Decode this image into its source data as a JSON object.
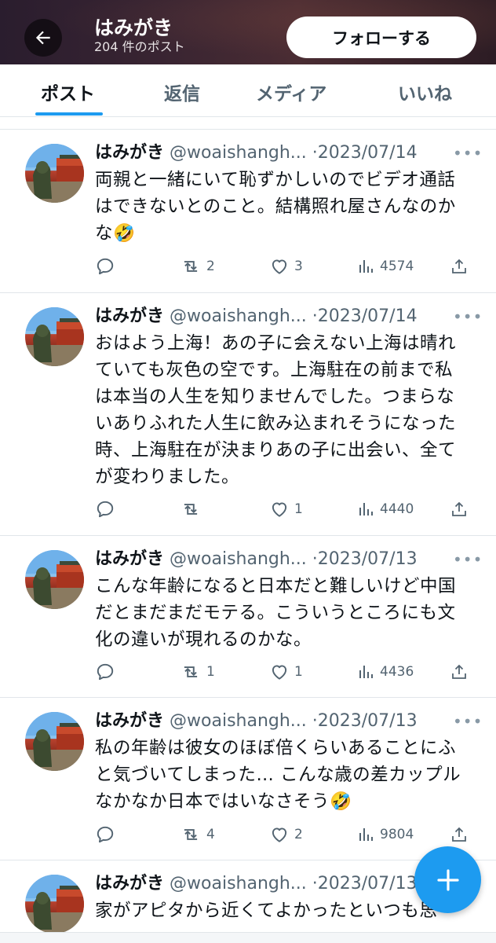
{
  "header": {
    "title": "はみがき",
    "post_count": "204 件のポスト",
    "follow_label": "フォローする"
  },
  "tabs": [
    "ポスト",
    "返信",
    "メディア",
    "いいね"
  ],
  "posts": [
    {
      "name": "はみがき",
      "handle": "@woaishangh...",
      "date": "·2023/07/14",
      "text": "両親と一緒にいて恥ずかしいのでビデオ通話はできないとのこと。結構照れ屋さんなのかな🤣",
      "replies": "",
      "reposts": "2",
      "likes": "3",
      "views": "4574"
    },
    {
      "name": "はみがき",
      "handle": "@woaishangh...",
      "date": "·2023/07/14",
      "text": "おはよう上海！あの子に会えない上海は晴れていても灰色の空です。上海駐在の前まで私は本当の人生を知りませんでした。つまらないありふれた人生に飲み込まれそうになった時、上海駐在が決まりあの子に出会い、全てが変わりました。",
      "replies": "",
      "reposts": "",
      "likes": "1",
      "views": "4440"
    },
    {
      "name": "はみがき",
      "handle": "@woaishangh...",
      "date": "·2023/07/13",
      "text": "こんな年齢になると日本だと難しいけど中国だとまだまだモテる。こういうところにも文化の違いが現れるのかな。",
      "replies": "",
      "reposts": "1",
      "likes": "1",
      "views": "4436"
    },
    {
      "name": "はみがき",
      "handle": "@woaishangh...",
      "date": "·2023/07/13",
      "text": "私の年齢は彼女のほぼ倍くらいあることにふと気づいてしまった… こんな歳の差カップルなかなか日本ではいなさそう🤣",
      "replies": "",
      "reposts": "4",
      "likes": "2",
      "views": "9804"
    },
    {
      "name": "はみがき",
      "handle": "@woaishangh...",
      "date": "·2023/07/13",
      "text": "家がアピタから近くてよかったといつも思"
    }
  ],
  "icons": {
    "back": "arrow-left-icon",
    "reply": "speech-bubble-icon",
    "repost": "repost-arrows-icon",
    "like": "heart-icon",
    "views": "bar-chart-icon",
    "share": "share-upload-icon",
    "compose": "plus-icon"
  },
  "colors": {
    "accent": "#1d9bf0",
    "text": "#0f1419",
    "muted": "#536471"
  }
}
